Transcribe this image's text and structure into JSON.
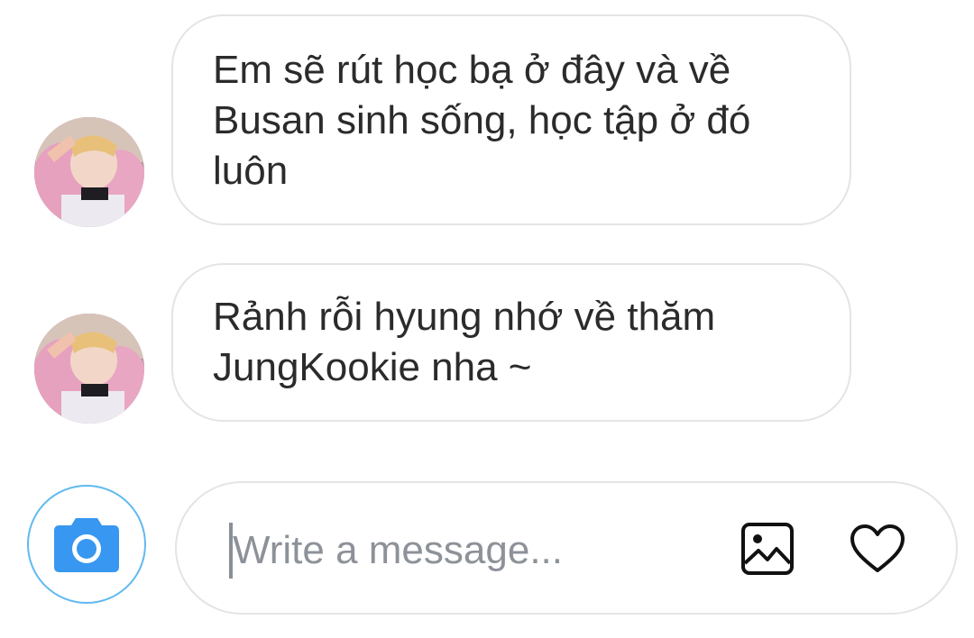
{
  "conversation": {
    "messages": [
      {
        "sender": "other",
        "avatar_icon": "profile-avatar",
        "text": "Em sẽ rút học bạ ở đây và về Busan sinh sống, học tập ở đó luôn"
      },
      {
        "sender": "other",
        "avatar_icon": "profile-avatar",
        "text": "Rảnh rỗi hyung nhớ về thăm JungKookie nha ~"
      }
    ]
  },
  "composer": {
    "camera_icon": "camera-icon",
    "placeholder": "Write a message...",
    "value": "",
    "gallery_icon": "image-gallery-icon",
    "like_icon": "heart-icon",
    "accent_color": "#3897f0"
  }
}
